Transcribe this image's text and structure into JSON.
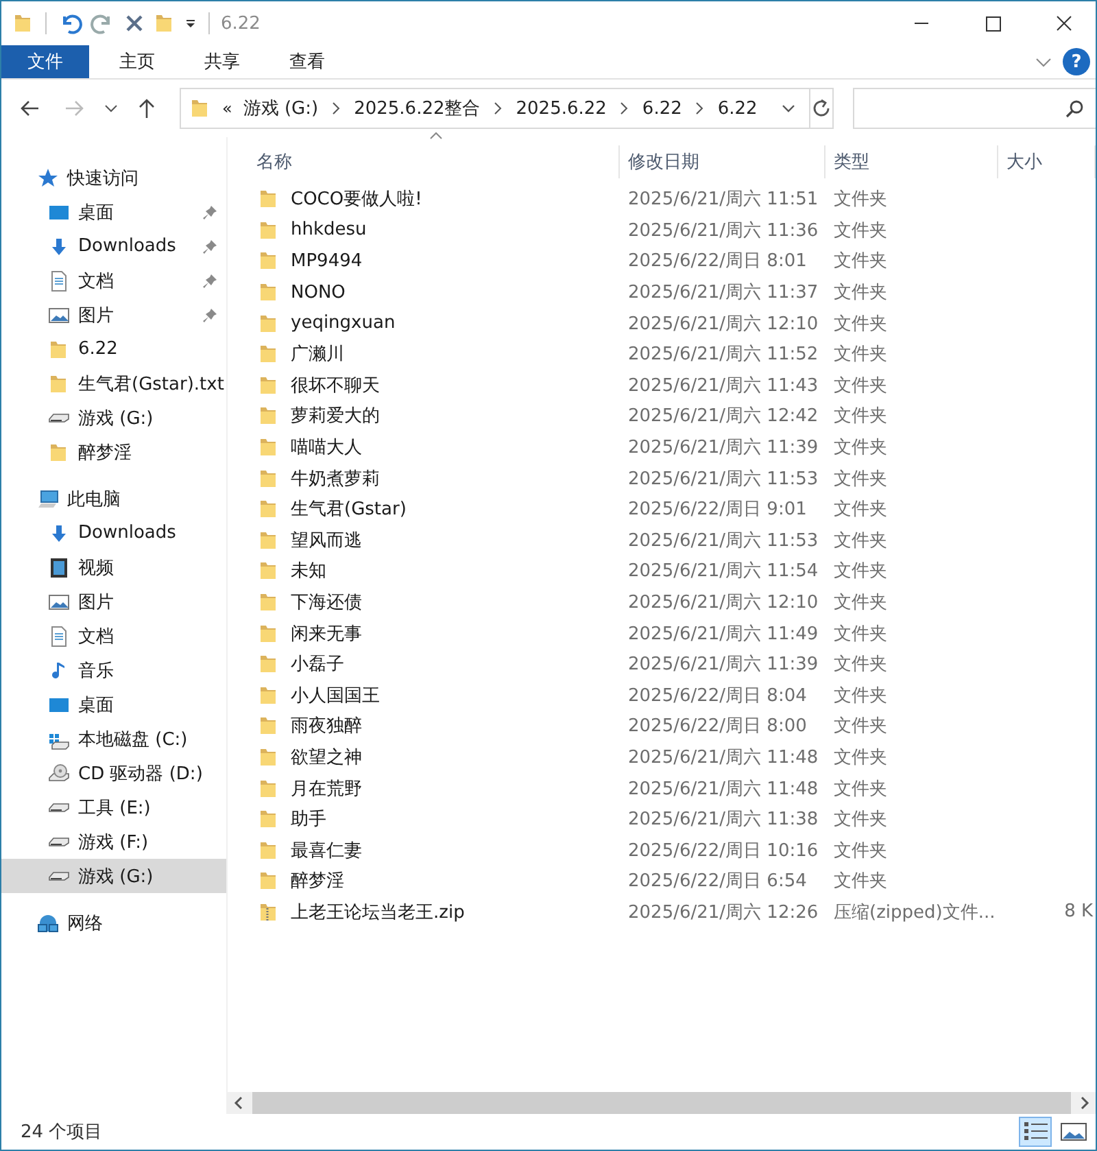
{
  "window": {
    "title": "6.22"
  },
  "ribbon": {
    "tabs": [
      {
        "label": "文件",
        "selected": true
      },
      {
        "label": "主页",
        "selected": false
      },
      {
        "label": "共享",
        "selected": false
      },
      {
        "label": "查看",
        "selected": false
      }
    ],
    "help": "?"
  },
  "navigation": {
    "back_enabled": true,
    "forward_enabled": false
  },
  "address_bar": {
    "overflow": "«",
    "crumbs": [
      "游戏 (G:)",
      "2025.6.22整合",
      "2025.6.22",
      "6.22",
      "6.22"
    ]
  },
  "sidebar": {
    "sections": [
      {
        "label": "快速访问",
        "kind": "star",
        "children": [
          {
            "label": "桌面",
            "kind": "desktop",
            "pinned": true,
            "selected": false
          },
          {
            "label": "Downloads",
            "kind": "download",
            "pinned": true,
            "selected": false
          },
          {
            "label": "文档",
            "kind": "document",
            "pinned": true,
            "selected": false
          },
          {
            "label": "图片",
            "kind": "picture",
            "pinned": true,
            "selected": false
          },
          {
            "label": "6.22",
            "kind": "folder",
            "pinned": false,
            "selected": false
          },
          {
            "label": "生气君(Gstar).txt",
            "kind": "folder",
            "pinned": false,
            "selected": false
          },
          {
            "label": "游戏 (G:)",
            "kind": "drive",
            "pinned": false,
            "selected": false
          },
          {
            "label": "醉梦淫",
            "kind": "folder",
            "pinned": false,
            "selected": false
          }
        ]
      },
      {
        "label": "此电脑",
        "kind": "computer",
        "children": [
          {
            "label": "Downloads",
            "kind": "download",
            "pinned": false,
            "selected": false
          },
          {
            "label": "视频",
            "kind": "video",
            "pinned": false,
            "selected": false
          },
          {
            "label": "图片",
            "kind": "picture",
            "pinned": false,
            "selected": false
          },
          {
            "label": "文档",
            "kind": "document",
            "pinned": false,
            "selected": false
          },
          {
            "label": "音乐",
            "kind": "music",
            "pinned": false,
            "selected": false
          },
          {
            "label": "桌面",
            "kind": "desktop",
            "pinned": false,
            "selected": false
          },
          {
            "label": "本地磁盘 (C:)",
            "kind": "system-drive",
            "pinned": false,
            "selected": false
          },
          {
            "label": "CD 驱动器 (D:)",
            "kind": "cd",
            "pinned": false,
            "selected": false
          },
          {
            "label": "工具 (E:)",
            "kind": "drive",
            "pinned": false,
            "selected": false
          },
          {
            "label": "游戏 (F:)",
            "kind": "drive",
            "pinned": false,
            "selected": false
          },
          {
            "label": "游戏 (G:)",
            "kind": "drive",
            "pinned": false,
            "selected": true
          }
        ]
      },
      {
        "label": "网络",
        "kind": "network"
      }
    ]
  },
  "table": {
    "columns": [
      "名称",
      "修改日期",
      "类型",
      "大小"
    ],
    "rows": [
      {
        "name": "COCO要做人啦!",
        "modified": "2025/6/21/周六 11:51",
        "type": "文件夹",
        "kind": "folder",
        "selected": false
      },
      {
        "name": "hhkdesu",
        "modified": "2025/6/21/周六 11:36",
        "type": "文件夹",
        "kind": "folder",
        "selected": false
      },
      {
        "name": "MP9494",
        "modified": "2025/6/22/周日 8:01",
        "type": "文件夹",
        "kind": "folder",
        "selected": false
      },
      {
        "name": "NONO",
        "modified": "2025/6/21/周六 11:37",
        "type": "文件夹",
        "kind": "folder",
        "selected": false
      },
      {
        "name": "yeqingxuan",
        "modified": "2025/6/21/周六 12:10",
        "type": "文件夹",
        "kind": "folder",
        "selected": false
      },
      {
        "name": "广濑川",
        "modified": "2025/6/21/周六 11:52",
        "type": "文件夹",
        "kind": "folder",
        "selected": false
      },
      {
        "name": "很坏不聊天",
        "modified": "2025/6/21/周六 11:43",
        "type": "文件夹",
        "kind": "folder",
        "selected": false
      },
      {
        "name": "萝莉爱大的",
        "modified": "2025/6/21/周六 12:42",
        "type": "文件夹",
        "kind": "folder",
        "selected": false
      },
      {
        "name": "喵喵大人",
        "modified": "2025/6/21/周六 11:39",
        "type": "文件夹",
        "kind": "folder",
        "selected": false
      },
      {
        "name": "牛奶煮萝莉",
        "modified": "2025/6/21/周六 11:53",
        "type": "文件夹",
        "kind": "folder",
        "selected": false
      },
      {
        "name": "生气君(Gstar)",
        "modified": "2025/6/22/周日 9:01",
        "type": "文件夹",
        "kind": "folder",
        "selected": false
      },
      {
        "name": "望风而逃",
        "modified": "2025/6/21/周六 11:53",
        "type": "文件夹",
        "kind": "folder",
        "selected": false
      },
      {
        "name": "未知",
        "modified": "2025/6/21/周六 11:54",
        "type": "文件夹",
        "kind": "folder",
        "selected": false
      },
      {
        "name": "下海还债",
        "modified": "2025/6/21/周六 12:10",
        "type": "文件夹",
        "kind": "folder",
        "selected": false
      },
      {
        "name": "闲来无事",
        "modified": "2025/6/21/周六 11:49",
        "type": "文件夹",
        "kind": "folder",
        "selected": false
      },
      {
        "name": "小磊子",
        "modified": "2025/6/21/周六 11:39",
        "type": "文件夹",
        "kind": "folder",
        "selected": false
      },
      {
        "name": "小人国国王",
        "modified": "2025/6/22/周日 8:04",
        "type": "文件夹",
        "kind": "folder",
        "selected": false
      },
      {
        "name": "雨夜独醉",
        "modified": "2025/6/22/周日 8:00",
        "type": "文件夹",
        "kind": "folder",
        "selected": false
      },
      {
        "name": "欲望之神",
        "modified": "2025/6/21/周六 11:48",
        "type": "文件夹",
        "kind": "folder",
        "selected": false
      },
      {
        "name": "月在荒野",
        "modified": "2025/6/21/周六 11:48",
        "type": "文件夹",
        "kind": "folder",
        "selected": false
      },
      {
        "name": "助手",
        "modified": "2025/6/21/周六 11:38",
        "type": "文件夹",
        "kind": "folder",
        "selected": false
      },
      {
        "name": "最喜仁妻",
        "modified": "2025/6/22/周日 10:16",
        "type": "文件夹",
        "kind": "folder",
        "selected": false
      },
      {
        "name": "醉梦淫",
        "modified": "2025/6/22/周日 6:54",
        "type": "文件夹",
        "kind": "folder",
        "selected": false
      },
      {
        "name": "上老王论坛当老王.zip",
        "modified": "2025/6/21/周六 12:26",
        "type": "压缩(zipped)文件...",
        "size": "8 K",
        "kind": "zip",
        "selected": false
      }
    ]
  },
  "status_bar": {
    "count": "24 个项目",
    "views": [
      {
        "kind": "details",
        "selected": true
      },
      {
        "kind": "large-icons",
        "selected": false
      }
    ]
  }
}
